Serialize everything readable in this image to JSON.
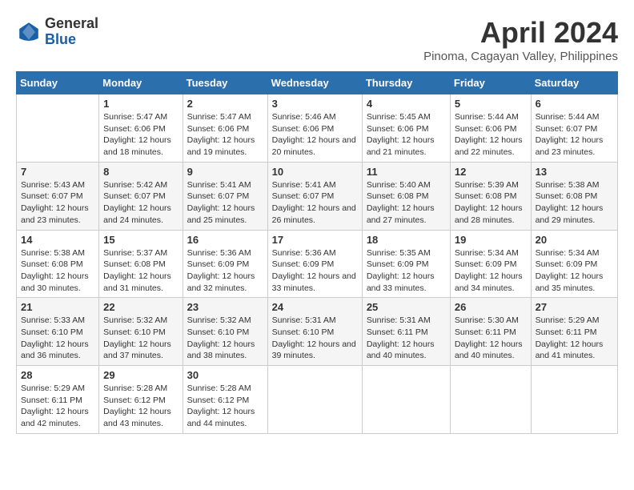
{
  "logo": {
    "general": "General",
    "blue": "Blue"
  },
  "title": "April 2024",
  "location": "Pinoma, Cagayan Valley, Philippines",
  "headers": [
    "Sunday",
    "Monday",
    "Tuesday",
    "Wednesday",
    "Thursday",
    "Friday",
    "Saturday"
  ],
  "weeks": [
    [
      {
        "day": "",
        "sunrise": "",
        "sunset": "",
        "daylight": ""
      },
      {
        "day": "1",
        "sunrise": "Sunrise: 5:47 AM",
        "sunset": "Sunset: 6:06 PM",
        "daylight": "Daylight: 12 hours and 18 minutes."
      },
      {
        "day": "2",
        "sunrise": "Sunrise: 5:47 AM",
        "sunset": "Sunset: 6:06 PM",
        "daylight": "Daylight: 12 hours and 19 minutes."
      },
      {
        "day": "3",
        "sunrise": "Sunrise: 5:46 AM",
        "sunset": "Sunset: 6:06 PM",
        "daylight": "Daylight: 12 hours and 20 minutes."
      },
      {
        "day": "4",
        "sunrise": "Sunrise: 5:45 AM",
        "sunset": "Sunset: 6:06 PM",
        "daylight": "Daylight: 12 hours and 21 minutes."
      },
      {
        "day": "5",
        "sunrise": "Sunrise: 5:44 AM",
        "sunset": "Sunset: 6:06 PM",
        "daylight": "Daylight: 12 hours and 22 minutes."
      },
      {
        "day": "6",
        "sunrise": "Sunrise: 5:44 AM",
        "sunset": "Sunset: 6:07 PM",
        "daylight": "Daylight: 12 hours and 23 minutes."
      }
    ],
    [
      {
        "day": "7",
        "sunrise": "Sunrise: 5:43 AM",
        "sunset": "Sunset: 6:07 PM",
        "daylight": "Daylight: 12 hours and 23 minutes."
      },
      {
        "day": "8",
        "sunrise": "Sunrise: 5:42 AM",
        "sunset": "Sunset: 6:07 PM",
        "daylight": "Daylight: 12 hours and 24 minutes."
      },
      {
        "day": "9",
        "sunrise": "Sunrise: 5:41 AM",
        "sunset": "Sunset: 6:07 PM",
        "daylight": "Daylight: 12 hours and 25 minutes."
      },
      {
        "day": "10",
        "sunrise": "Sunrise: 5:41 AM",
        "sunset": "Sunset: 6:07 PM",
        "daylight": "Daylight: 12 hours and 26 minutes."
      },
      {
        "day": "11",
        "sunrise": "Sunrise: 5:40 AM",
        "sunset": "Sunset: 6:08 PM",
        "daylight": "Daylight: 12 hours and 27 minutes."
      },
      {
        "day": "12",
        "sunrise": "Sunrise: 5:39 AM",
        "sunset": "Sunset: 6:08 PM",
        "daylight": "Daylight: 12 hours and 28 minutes."
      },
      {
        "day": "13",
        "sunrise": "Sunrise: 5:38 AM",
        "sunset": "Sunset: 6:08 PM",
        "daylight": "Daylight: 12 hours and 29 minutes."
      }
    ],
    [
      {
        "day": "14",
        "sunrise": "Sunrise: 5:38 AM",
        "sunset": "Sunset: 6:08 PM",
        "daylight": "Daylight: 12 hours and 30 minutes."
      },
      {
        "day": "15",
        "sunrise": "Sunrise: 5:37 AM",
        "sunset": "Sunset: 6:08 PM",
        "daylight": "Daylight: 12 hours and 31 minutes."
      },
      {
        "day": "16",
        "sunrise": "Sunrise: 5:36 AM",
        "sunset": "Sunset: 6:09 PM",
        "daylight": "Daylight: 12 hours and 32 minutes."
      },
      {
        "day": "17",
        "sunrise": "Sunrise: 5:36 AM",
        "sunset": "Sunset: 6:09 PM",
        "daylight": "Daylight: 12 hours and 33 minutes."
      },
      {
        "day": "18",
        "sunrise": "Sunrise: 5:35 AM",
        "sunset": "Sunset: 6:09 PM",
        "daylight": "Daylight: 12 hours and 33 minutes."
      },
      {
        "day": "19",
        "sunrise": "Sunrise: 5:34 AM",
        "sunset": "Sunset: 6:09 PM",
        "daylight": "Daylight: 12 hours and 34 minutes."
      },
      {
        "day": "20",
        "sunrise": "Sunrise: 5:34 AM",
        "sunset": "Sunset: 6:09 PM",
        "daylight": "Daylight: 12 hours and 35 minutes."
      }
    ],
    [
      {
        "day": "21",
        "sunrise": "Sunrise: 5:33 AM",
        "sunset": "Sunset: 6:10 PM",
        "daylight": "Daylight: 12 hours and 36 minutes."
      },
      {
        "day": "22",
        "sunrise": "Sunrise: 5:32 AM",
        "sunset": "Sunset: 6:10 PM",
        "daylight": "Daylight: 12 hours and 37 minutes."
      },
      {
        "day": "23",
        "sunrise": "Sunrise: 5:32 AM",
        "sunset": "Sunset: 6:10 PM",
        "daylight": "Daylight: 12 hours and 38 minutes."
      },
      {
        "day": "24",
        "sunrise": "Sunrise: 5:31 AM",
        "sunset": "Sunset: 6:10 PM",
        "daylight": "Daylight: 12 hours and 39 minutes."
      },
      {
        "day": "25",
        "sunrise": "Sunrise: 5:31 AM",
        "sunset": "Sunset: 6:11 PM",
        "daylight": "Daylight: 12 hours and 40 minutes."
      },
      {
        "day": "26",
        "sunrise": "Sunrise: 5:30 AM",
        "sunset": "Sunset: 6:11 PM",
        "daylight": "Daylight: 12 hours and 40 minutes."
      },
      {
        "day": "27",
        "sunrise": "Sunrise: 5:29 AM",
        "sunset": "Sunset: 6:11 PM",
        "daylight": "Daylight: 12 hours and 41 minutes."
      }
    ],
    [
      {
        "day": "28",
        "sunrise": "Sunrise: 5:29 AM",
        "sunset": "Sunset: 6:11 PM",
        "daylight": "Daylight: 12 hours and 42 minutes."
      },
      {
        "day": "29",
        "sunrise": "Sunrise: 5:28 AM",
        "sunset": "Sunset: 6:12 PM",
        "daylight": "Daylight: 12 hours and 43 minutes."
      },
      {
        "day": "30",
        "sunrise": "Sunrise: 5:28 AM",
        "sunset": "Sunset: 6:12 PM",
        "daylight": "Daylight: 12 hours and 44 minutes."
      },
      {
        "day": "",
        "sunrise": "",
        "sunset": "",
        "daylight": ""
      },
      {
        "day": "",
        "sunrise": "",
        "sunset": "",
        "daylight": ""
      },
      {
        "day": "",
        "sunrise": "",
        "sunset": "",
        "daylight": ""
      },
      {
        "day": "",
        "sunrise": "",
        "sunset": "",
        "daylight": ""
      }
    ]
  ]
}
